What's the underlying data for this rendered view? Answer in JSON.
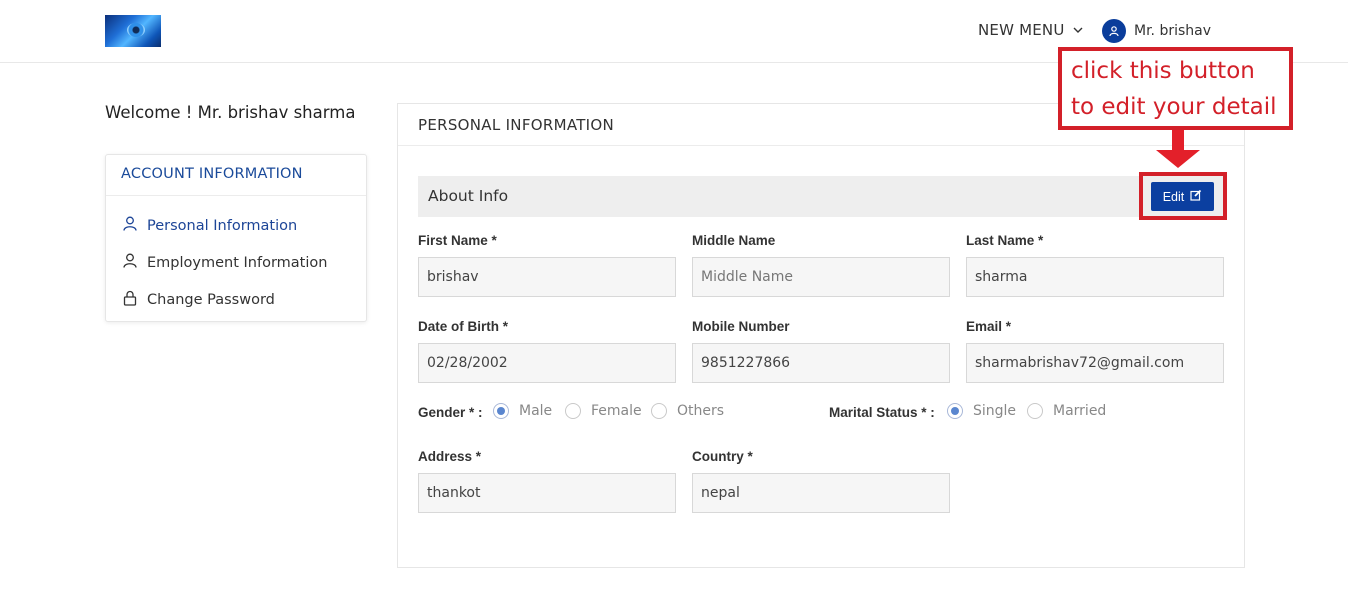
{
  "header": {
    "new_menu": "NEW MENU",
    "user_name": "Mr. brishav",
    "icons": {
      "chevron": "chevron-down-icon",
      "avatar": "user-icon"
    }
  },
  "sidebar": {
    "welcome": "Welcome ! Mr. brishav sharma",
    "card_title": "ACCOUNT INFORMATION",
    "items": [
      {
        "label": "Personal Information",
        "icon": "user-icon",
        "active": true
      },
      {
        "label": "Employment Information",
        "icon": "user-icon",
        "active": false
      },
      {
        "label": "Change Password",
        "icon": "lock-icon",
        "active": false
      }
    ]
  },
  "main": {
    "title": "PERSONAL INFORMATION",
    "section": "About Info",
    "edit_label": "Edit",
    "fields": {
      "first_name": {
        "label": "First Name *",
        "value": "brishav",
        "placeholder": ""
      },
      "middle_name": {
        "label": "Middle Name",
        "value": "",
        "placeholder": "Middle Name"
      },
      "last_name": {
        "label": "Last Name *",
        "value": "sharma",
        "placeholder": ""
      },
      "dob": {
        "label": "Date of Birth *",
        "value": "02/28/2002",
        "placeholder": ""
      },
      "mobile": {
        "label": "Mobile Number",
        "value": "9851227866",
        "placeholder": ""
      },
      "email": {
        "label": "Email *",
        "value": "sharmabrishav72@gmail.com",
        "placeholder": ""
      },
      "address": {
        "label": "Address *",
        "value": "thankot",
        "placeholder": ""
      },
      "country": {
        "label": "Country *",
        "value": "nepal",
        "placeholder": ""
      }
    },
    "gender": {
      "label": "Gender * :",
      "options": [
        "Male",
        "Female",
        "Others"
      ],
      "selected": "Male"
    },
    "marital": {
      "label": "Marital Status * :",
      "options": [
        "Single",
        "Married"
      ],
      "selected": "Single"
    }
  },
  "annotation": {
    "line1": "click this button",
    "line2": "to edit your detail",
    "color": "#d32029"
  },
  "colors": {
    "primary": "#0b3fa0",
    "link": "#1d4597",
    "highlight": "#d32029"
  }
}
